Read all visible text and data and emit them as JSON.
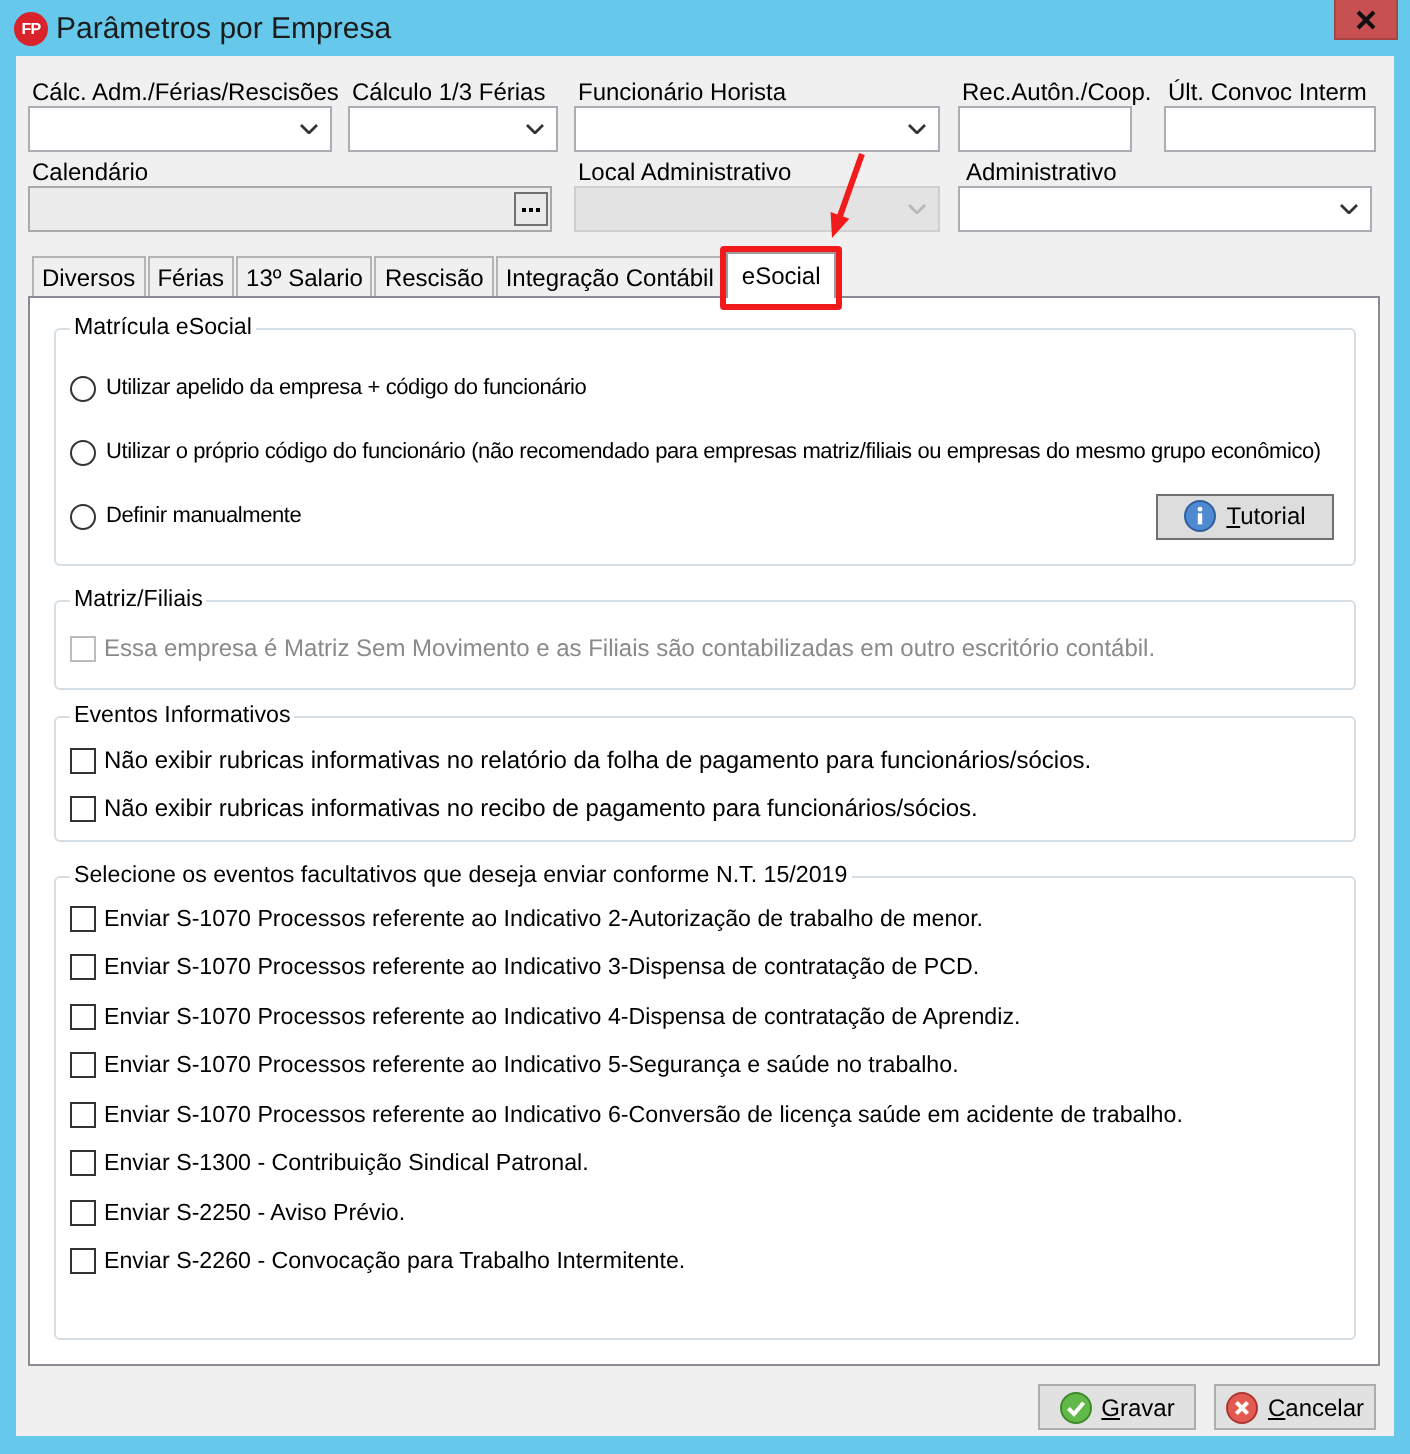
{
  "window": {
    "logo": "FP",
    "title": "Parâmetros por Empresa"
  },
  "top_fields": [
    [
      {
        "label": "Cálc. Adm./Férias/Rescisões",
        "kind": "combo",
        "disabled": false
      },
      {
        "label": "Cálculo 1/3 Férias",
        "kind": "combo",
        "disabled": false
      },
      {
        "label": "Funcionário Horista",
        "kind": "combo",
        "disabled": false
      },
      {
        "label": "Rec.Autôn./Coop.",
        "kind": "text",
        "disabled": false
      },
      {
        "label": "Últ. Convoc Interm",
        "kind": "text",
        "disabled": false
      }
    ],
    [
      {
        "label": "Calendário",
        "kind": "browse",
        "disabled": true
      },
      {
        "label": "Local Administrativo",
        "kind": "combo",
        "disabled": true
      },
      {
        "label": "Administrativo",
        "kind": "combo",
        "disabled": false
      }
    ]
  ],
  "tabs": [
    {
      "label": "Diversos",
      "selected": false,
      "highlighted": false
    },
    {
      "label": "Férias",
      "selected": false,
      "highlighted": false
    },
    {
      "label": "13º Salario",
      "selected": false,
      "highlighted": false
    },
    {
      "label": "Rescisão",
      "selected": false,
      "highlighted": false
    },
    {
      "label": "Integração Contábil",
      "selected": false,
      "highlighted": false
    },
    {
      "label": "eSocial",
      "selected": true,
      "highlighted": true
    }
  ],
  "groups": [
    {
      "title": "Matrícula eSocial",
      "items": [
        {
          "kind": "radio",
          "label": "Utilizar apelido da empresa + código do funcionário",
          "selected": false
        },
        {
          "kind": "radio",
          "label": "Utilizar o próprio código do funcionário (não recomendado para empresas matriz/filiais ou empresas do mesmo grupo econômico)",
          "selected": false
        },
        {
          "kind": "radio",
          "label": "Definir manualmente",
          "selected": false
        }
      ],
      "button": {
        "label": "Tutorial",
        "kind": "info"
      }
    },
    {
      "title": "Matriz/Filiais",
      "items": [
        {
          "kind": "checkbox",
          "label": "Essa empresa é Matriz Sem Movimento e as Filiais são contabilizadas em outro escritório contábil.",
          "checked": false,
          "disabled": true
        }
      ]
    },
    {
      "title": "Eventos Informativos",
      "items": [
        {
          "kind": "checkbox",
          "label": "Não exibir rubricas informativas no relatório da folha de pagamento para funcionários/sócios.",
          "checked": false,
          "disabled": false
        },
        {
          "kind": "checkbox",
          "label": "Não exibir rubricas informativas no recibo de pagamento para funcionários/sócios.",
          "checked": false,
          "disabled": false
        }
      ]
    },
    {
      "title": "Selecione os eventos facultativos que deseja enviar conforme N.T. 15/2019",
      "items": [
        {
          "kind": "checkbox",
          "label": "Enviar S-1070 Processos referente ao Indicativo 2-Autorização de trabalho de menor.",
          "checked": false,
          "disabled": false
        },
        {
          "kind": "checkbox",
          "label": "Enviar S-1070 Processos referente ao Indicativo 3-Dispensa de contratação de PCD.",
          "checked": false,
          "disabled": false
        },
        {
          "kind": "checkbox",
          "label": "Enviar S-1070 Processos referente ao Indicativo 4-Dispensa de contratação de Aprendiz.",
          "checked": false,
          "disabled": false
        },
        {
          "kind": "checkbox",
          "label": "Enviar S-1070 Processos referente ao Indicativo 5-Segurança e saúde no trabalho.",
          "checked": false,
          "disabled": false
        },
        {
          "kind": "checkbox",
          "label": "Enviar S-1070 Processos referente ao Indicativo 6-Conversão de licença saúde em acidente de trabalho.",
          "checked": false,
          "disabled": false
        },
        {
          "kind": "checkbox",
          "label": "Enviar S-1300 - Contribuição Sindical Patronal.",
          "checked": false,
          "disabled": false
        },
        {
          "kind": "checkbox",
          "label": "Enviar S-2250 - Aviso Prévio.",
          "checked": false,
          "disabled": false
        },
        {
          "kind": "checkbox",
          "label": "Enviar S-2260 - Convocação para Trabalho Intermitente.",
          "checked": false,
          "disabled": false
        }
      ]
    }
  ],
  "buttons": [
    {
      "label": "Gravar",
      "kind": "save"
    },
    {
      "label": "Cancelar",
      "kind": "cancel"
    }
  ]
}
